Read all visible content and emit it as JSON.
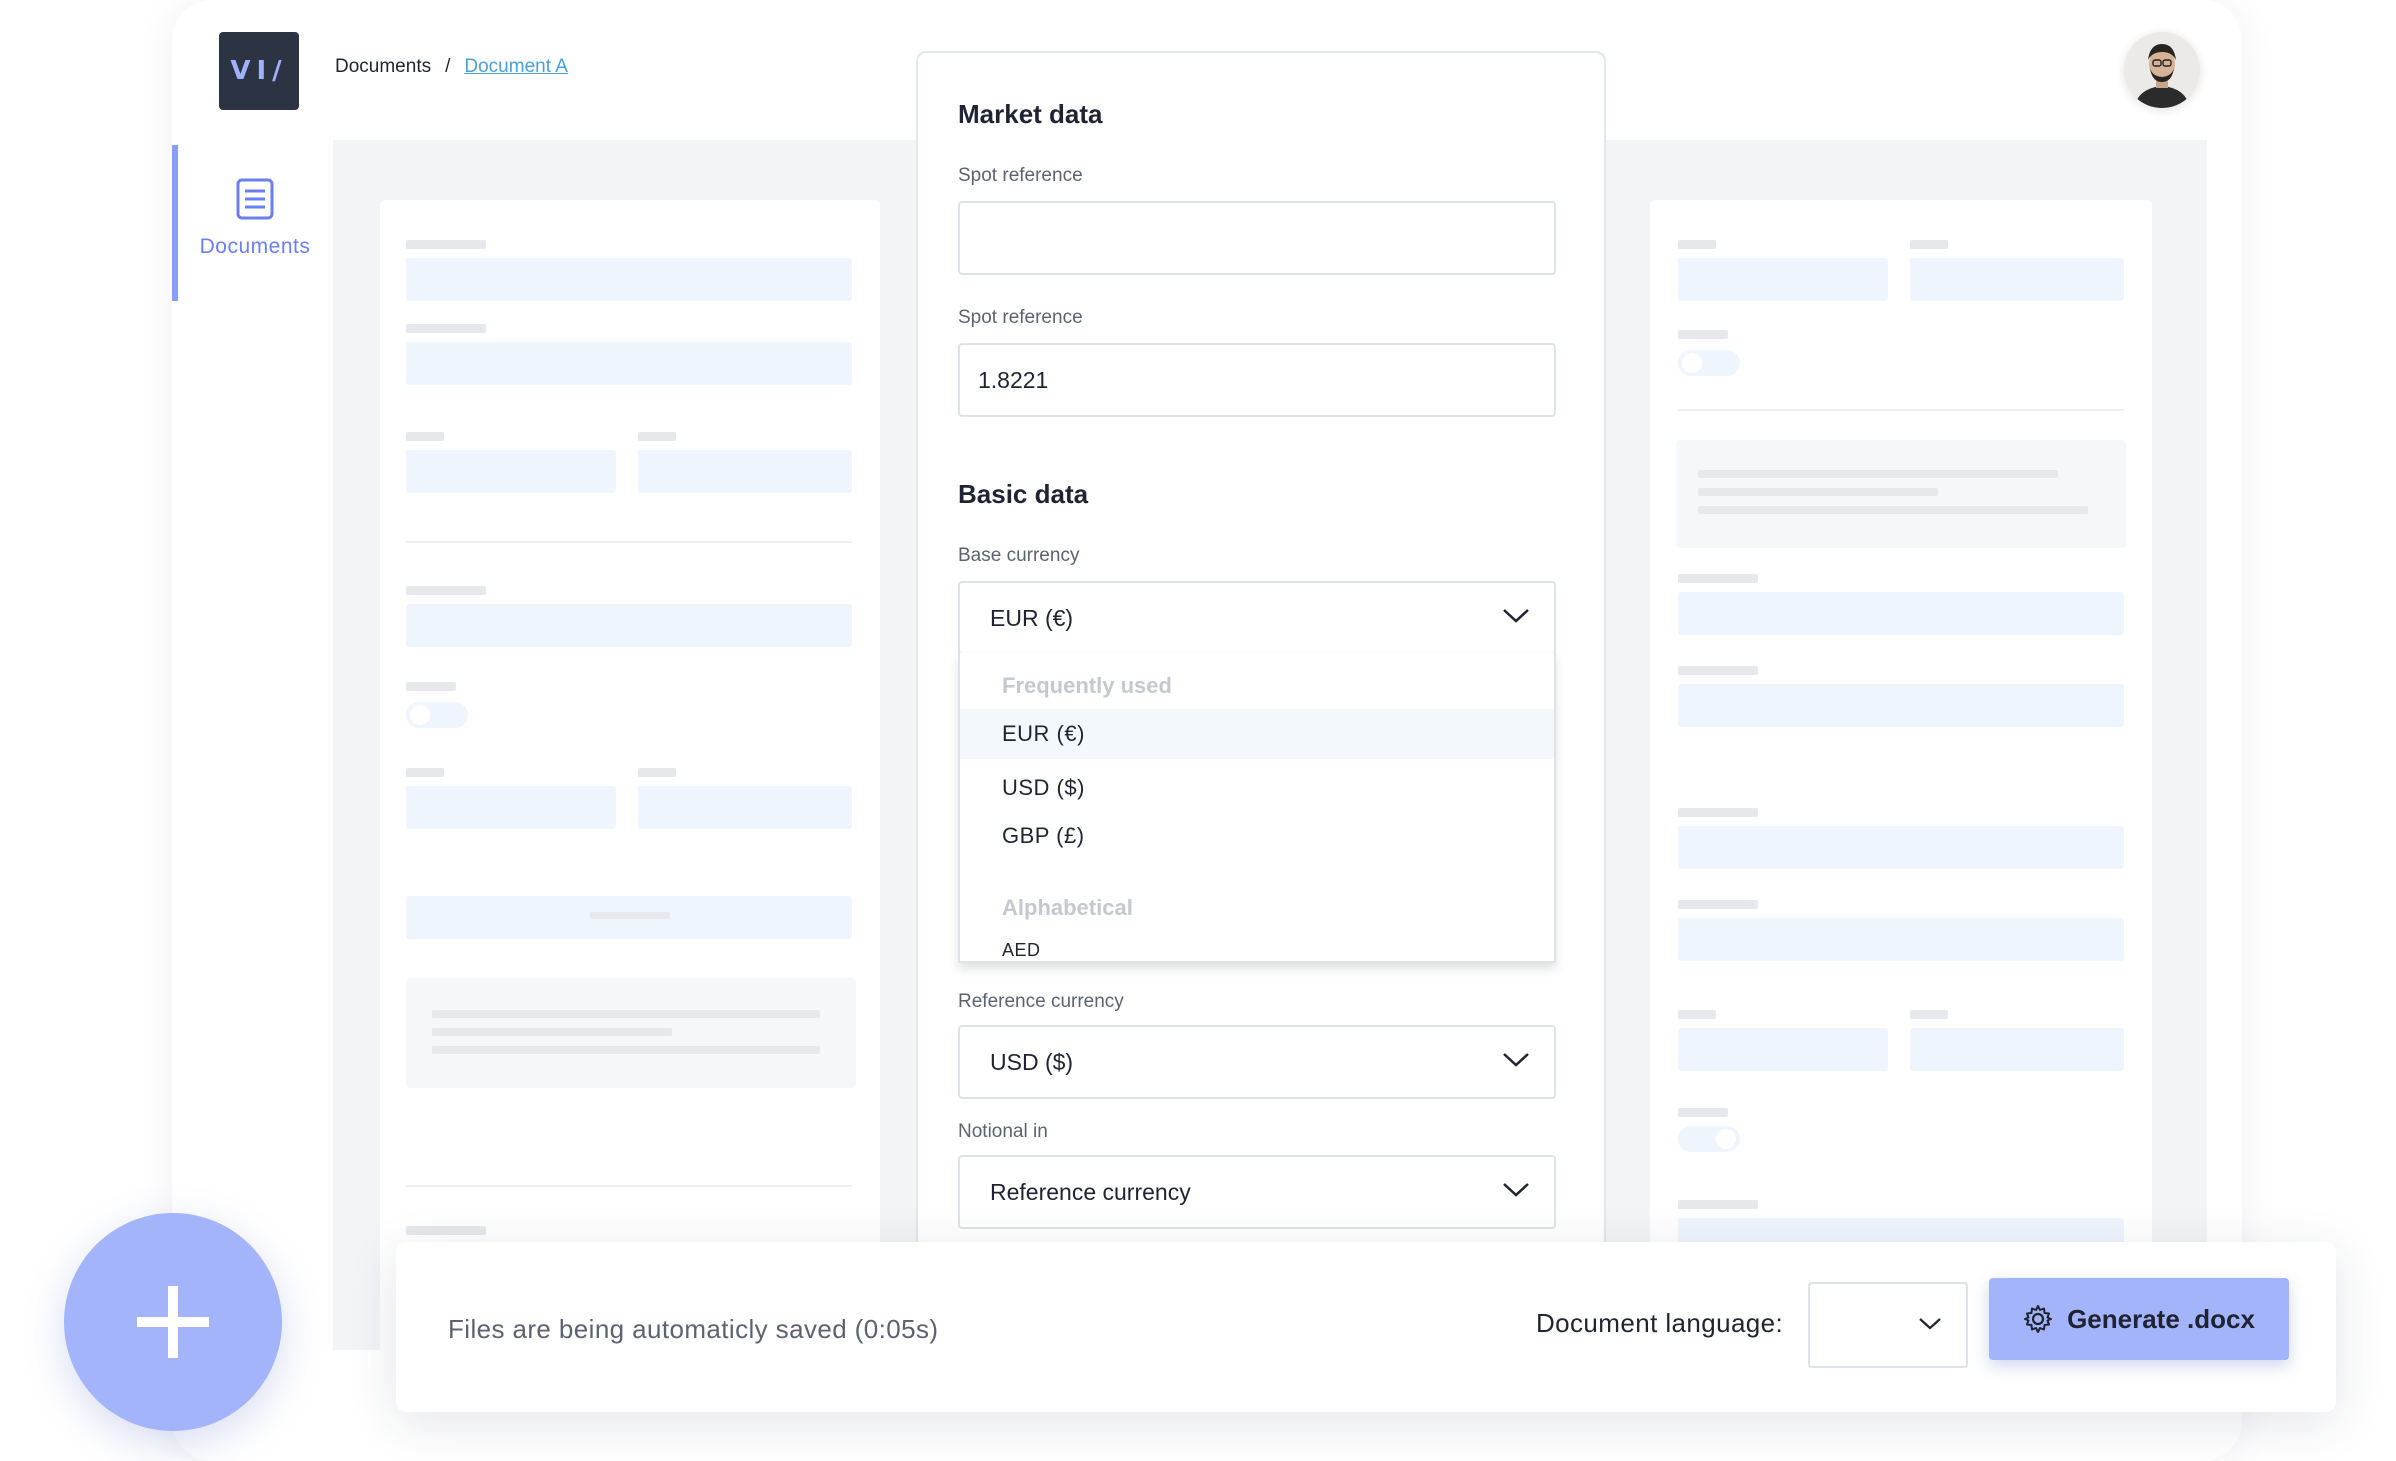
{
  "header": {
    "logo_text": "VI/",
    "breadcrumb": {
      "root": "Documents",
      "separator": "/",
      "current": "Document A"
    }
  },
  "sidebar": {
    "items": [
      {
        "label": "Documents",
        "icon": "document-icon",
        "active": true
      }
    ]
  },
  "form": {
    "market_data": {
      "title": "Market data",
      "spot_reference_1": {
        "label": "Spot reference",
        "value": ""
      },
      "spot_reference_2": {
        "label": "Spot reference",
        "value": "1.8221"
      }
    },
    "basic_data": {
      "title": "Basic data",
      "base_currency": {
        "label": "Base currency",
        "value": "EUR (€)",
        "dropdown": {
          "groups": [
            {
              "label": "Frequently used",
              "options": [
                "EUR (€)",
                "USD ($)",
                "GBP (£)"
              ]
            },
            {
              "label": "Alphabetical",
              "options": [
                "AED"
              ]
            }
          ],
          "highlighted": "EUR (€)"
        }
      },
      "reference_currency": {
        "label": "Reference currency",
        "value": "USD ($)"
      },
      "notional_in": {
        "label": "Notional in",
        "value": "Reference currency"
      }
    }
  },
  "footer": {
    "save_status": "Files are being automaticly saved (0:05s)",
    "language_label": "Document language:",
    "language_value": "",
    "generate_label": "Generate .docx"
  },
  "colors": {
    "accent": "#a4b4fb",
    "sidebar_active": "#8a9df7",
    "link": "#4aa0d8",
    "logo_bg": "#2c3444"
  }
}
